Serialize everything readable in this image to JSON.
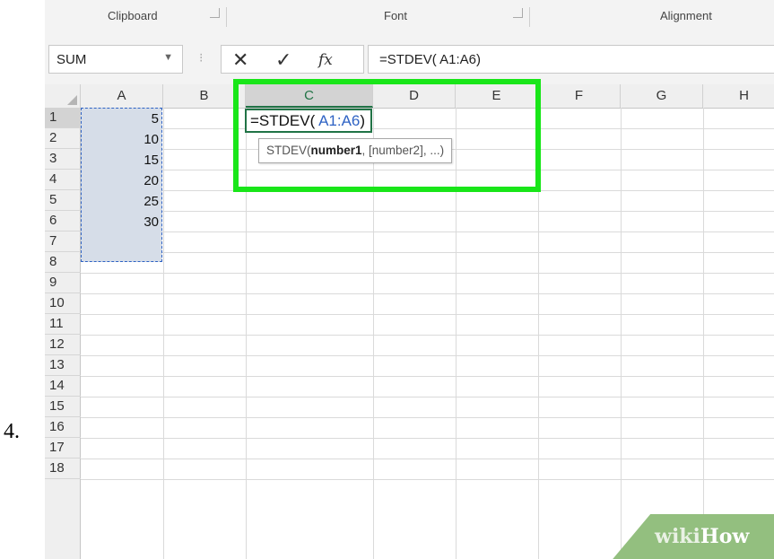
{
  "step": "4.",
  "ribbon": {
    "groups": [
      "Clipboard",
      "Font",
      "Alignment"
    ]
  },
  "formula_bar": {
    "name_box": "SUM",
    "cancel_icon": "close-icon",
    "enter_icon": "check-icon",
    "fx_label": "fx",
    "formula": "=STDEV( A1:A6)"
  },
  "sheet": {
    "columns": [
      "A",
      "B",
      "C",
      "D",
      "E",
      "F",
      "G",
      "H"
    ],
    "rows": [
      "1",
      "2",
      "3",
      "4",
      "5",
      "6",
      "7",
      "8",
      "9",
      "10",
      "11",
      "12",
      "13",
      "14",
      "15",
      "16",
      "17",
      "18"
    ],
    "column_a_values": [
      "5",
      "10",
      "15",
      "20",
      "25",
      "30"
    ],
    "active_cell": {
      "prefix": "=STDEV( ",
      "reference": "A1:A6",
      "suffix": ")"
    },
    "tooltip": {
      "function": "STDEV(",
      "arg1": "number1",
      "rest": ", [number2], ...)"
    }
  },
  "colors": {
    "highlight": "#19e619",
    "selection_fill": "#d6dde8",
    "reference_blue": "#2f63c4",
    "excel_green": "#217346"
  },
  "watermark": {
    "part1": "wiki",
    "part2": "How"
  }
}
